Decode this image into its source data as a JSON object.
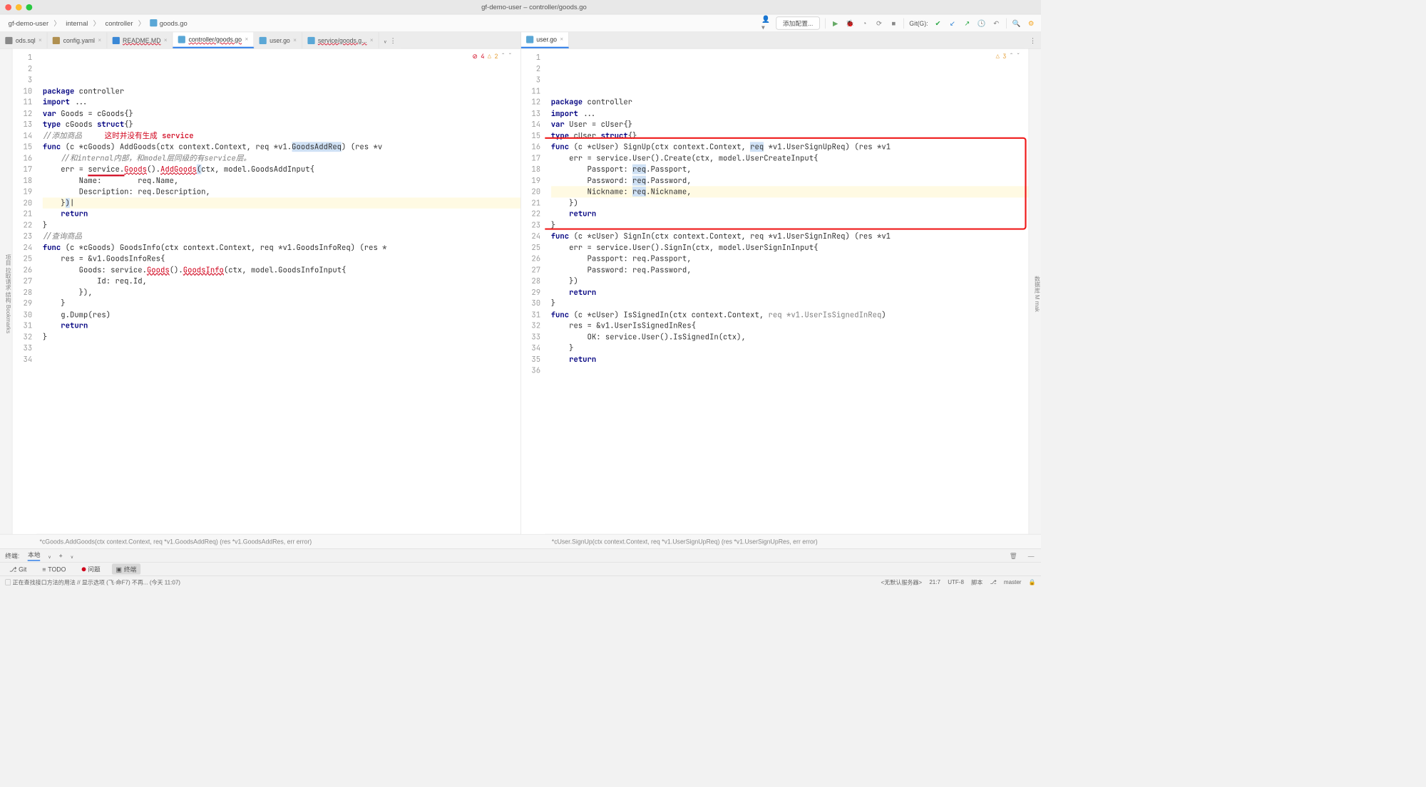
{
  "window": {
    "title": "gf-demo-user – controller/goods.go"
  },
  "breadcrumbs": [
    "gf-demo-user",
    "internal",
    "controller",
    "goods.go"
  ],
  "toolbar": {
    "config_label": "添加配置...",
    "git_label": "Git(G):"
  },
  "tabs_left": [
    {
      "label": "ods.sql",
      "icon": "sql"
    },
    {
      "label": "config.yaml",
      "icon": "yaml"
    },
    {
      "label": "README.MD",
      "icon": "md",
      "wavy": true
    },
    {
      "label": "controller/goods.go",
      "icon": "go",
      "active": true,
      "wavy": true
    },
    {
      "label": "user.go",
      "icon": "go"
    },
    {
      "label": "service/goods.g...",
      "icon": "go",
      "wavy": true
    }
  ],
  "tabs_right": [
    {
      "label": "user.go",
      "icon": "go",
      "active": true
    }
  ],
  "left_editor": {
    "errors": 4,
    "warnings": 2,
    "gutter": [
      "1",
      "2",
      "3",
      "10",
      "11",
      "12",
      "13",
      "14",
      "15",
      "16",
      "17",
      "18",
      "19",
      "20",
      "21",
      "22",
      "23",
      "24",
      "25",
      "26",
      "27",
      "28",
      "29",
      "30",
      "31",
      "32",
      "33",
      "34"
    ],
    "lines": [
      {
        "t": "package controller",
        "parts": [
          [
            "kw",
            "package "
          ],
          [
            "",
            "controller"
          ]
        ]
      },
      {
        "t": ""
      },
      {
        "t": "import ...",
        "parts": [
          [
            "kw",
            "import "
          ],
          [
            "",
            "..."
          ]
        ]
      },
      {
        "t": ""
      },
      {
        "t": "var Goods = cGoods{}",
        "parts": [
          [
            "kw",
            "var "
          ],
          [
            "",
            "Goods = cGoods{}"
          ]
        ]
      },
      {
        "t": ""
      },
      {
        "t": "type cGoods struct{}",
        "parts": [
          [
            "kw",
            "type "
          ],
          [
            "",
            "cGoods "
          ],
          [
            "kw",
            "struct"
          ],
          [
            "",
            "{}"
          ]
        ]
      },
      {
        "t": ""
      },
      {
        "t": "//添加商品     这时并没有生成 service",
        "parts": [
          [
            "cmt",
            "//添加商品     "
          ],
          [
            "errtxt",
            "这时并没有生成 service"
          ]
        ]
      },
      {
        "t": "func (c *cGoods) AddGoods(ctx context.Context, req *v1.GoodsAddReq) (res *v",
        "parts": [
          [
            "kw",
            "func "
          ],
          [
            "",
            "(c *cGoods) AddGoods(ctx context.Context, req *v1."
          ],
          [
            "sel",
            "GoodsAddReq"
          ],
          [
            "",
            ") (res *v"
          ]
        ]
      },
      {
        "t": "    //和internal内部，和model层同级的有service层。",
        "parts": [
          [
            "cmti",
            "    //和internal内部，和model层同级的有service层。"
          ]
        ]
      },
      {
        "t": "    err = service.Goods().AddGoods(ctx, model.GoodsAddInput{",
        "parts": [
          [
            "",
            "    err = "
          ],
          [
            "red-under",
            "service"
          ],
          [
            "",
            ""
          ],
          [
            "red-under",
            "."
          ],
          [
            "err",
            "Goods"
          ],
          [
            "",
            "()."
          ],
          [
            "err",
            "AddGoods"
          ],
          [
            "sel",
            "("
          ],
          [
            "",
            "ctx, model.GoodsAddInput{"
          ]
        ]
      },
      {
        "t": "        Name:        req.Name,",
        "parts": [
          [
            "",
            "        Name:        req.Name,"
          ]
        ]
      },
      {
        "t": "        Description: req.Description,",
        "parts": [
          [
            "",
            "        Description: req.Description,"
          ]
        ]
      },
      {
        "t": "    })",
        "hl": true,
        "parts": [
          [
            "",
            "    }"
          ],
          [
            "sel",
            ")"
          ],
          [
            "",
            "|"
          ]
        ]
      },
      {
        "t": "    return",
        "parts": [
          [
            "",
            "    "
          ],
          [
            "kw",
            "return"
          ]
        ]
      },
      {
        "t": "}",
        "parts": [
          [
            "",
            "}"
          ]
        ]
      },
      {
        "t": ""
      },
      {
        "t": "//查询商品",
        "parts": [
          [
            "cmt",
            "//查询商品"
          ]
        ]
      },
      {
        "t": "func (c *cGoods) GoodsInfo(ctx context.Context, req *v1.GoodsInfoReq) (res *",
        "parts": [
          [
            "kw",
            "func "
          ],
          [
            "",
            "(c *cGoods) GoodsInfo(ctx context.Context, req *v1.GoodsInfoReq) (res *"
          ]
        ]
      },
      {
        "t": "    res = &v1.GoodsInfoRes{",
        "parts": [
          [
            "",
            "    res = &v1.GoodsInfoRes{"
          ]
        ]
      },
      {
        "t": "        Goods: service.Goods().GoodsInfo(ctx, model.GoodsInfoInput{",
        "parts": [
          [
            "",
            "        Goods: service."
          ],
          [
            "err",
            "Goods"
          ],
          [
            "",
            "()."
          ],
          [
            "err",
            "GoodsInfo"
          ],
          [
            "",
            "(ctx, model.GoodsInfoInput{"
          ]
        ]
      },
      {
        "t": "            Id: req.Id,",
        "parts": [
          [
            "",
            "            Id: req.Id,"
          ]
        ]
      },
      {
        "t": "        }),",
        "parts": [
          [
            "",
            "        }),"
          ]
        ]
      },
      {
        "t": "    }",
        "parts": [
          [
            "",
            "    }"
          ]
        ]
      },
      {
        "t": "    g.Dump(res)",
        "parts": [
          [
            "",
            "    g.Dump(res)"
          ]
        ]
      },
      {
        "t": "    return",
        "parts": [
          [
            "",
            "    "
          ],
          [
            "kw",
            "return"
          ]
        ]
      },
      {
        "t": "}",
        "parts": [
          [
            "",
            "}"
          ]
        ]
      }
    ],
    "crumb": "*cGoods.AddGoods(ctx context.Context, req *v1.GoodsAddReq) (res *v1.GoodsAddRes, err error)"
  },
  "right_editor": {
    "warnings": 3,
    "gutter": [
      "1",
      "2",
      "3",
      "11",
      "12",
      "13",
      "14",
      "15",
      "16",
      "17",
      "18",
      "19",
      "20",
      "21",
      "22",
      "23",
      "24",
      "25",
      "26",
      "27",
      "28",
      "29",
      "30",
      "31",
      "32",
      "33",
      "34",
      "35",
      "36"
    ],
    "lines": [
      {
        "t": "package controller",
        "parts": [
          [
            "kw",
            "package "
          ],
          [
            "",
            "controller"
          ]
        ]
      },
      {
        "t": ""
      },
      {
        "t": "import ...",
        "parts": [
          [
            "kw",
            "import "
          ],
          [
            "",
            "..."
          ]
        ]
      },
      {
        "t": ""
      },
      {
        "t": "var User = cUser{}",
        "parts": [
          [
            "kw",
            "var "
          ],
          [
            "",
            "User = cUser{}"
          ]
        ]
      },
      {
        "t": ""
      },
      {
        "t": "type cUser struct{}",
        "parts": [
          [
            "kw",
            "type "
          ],
          [
            "",
            "cUser "
          ],
          [
            "kw",
            "struct"
          ],
          [
            "",
            "{}"
          ]
        ]
      },
      {
        "t": ""
      },
      {
        "t": "func (c *cUser) SignUp(ctx context.Context, req *v1.UserSignUpReq) (res *v1",
        "parts": [
          [
            "kw",
            "func "
          ],
          [
            "",
            "(c *cUser) SignUp(ctx context.Context, "
          ],
          [
            "sel",
            "req"
          ],
          [
            "",
            " *v1.UserSignUpReq) (res *v1"
          ]
        ]
      },
      {
        "t": "    err = service.User().Create(ctx, model.UserCreateInput{",
        "parts": [
          [
            "",
            "    err = service.User().Create(ctx, model.UserCreateInput{"
          ]
        ]
      },
      {
        "t": "        Passport: req.Passport,",
        "parts": [
          [
            "",
            "        Passport: "
          ],
          [
            "sel",
            "req"
          ],
          [
            "",
            ".Passport,"
          ]
        ]
      },
      {
        "t": "        Password: req.Password,",
        "parts": [
          [
            "",
            "        Password: "
          ],
          [
            "sel",
            "req"
          ],
          [
            "",
            ".Password,"
          ]
        ]
      },
      {
        "t": "        Nickname: req.Nickname,",
        "hl": true,
        "parts": [
          [
            "",
            "        Nickname: "
          ],
          [
            "sel",
            "req"
          ],
          [
            "",
            ".Nickname,"
          ]
        ]
      },
      {
        "t": "    })",
        "parts": [
          [
            "",
            "    })"
          ]
        ]
      },
      {
        "t": "    return",
        "parts": [
          [
            "",
            "    "
          ],
          [
            "kw",
            "return"
          ]
        ]
      },
      {
        "t": "}",
        "parts": [
          [
            "",
            "}"
          ]
        ]
      },
      {
        "t": "func (c *cUser) SignIn(ctx context.Context, req *v1.UserSignInReq) (res *v1",
        "parts": [
          [
            "kw",
            "func "
          ],
          [
            "",
            "(c *cUser) SignIn(ctx context.Context, req *v1.UserSignInReq) (res *v1"
          ]
        ]
      },
      {
        "t": "    err = service.User().SignIn(ctx, model.UserSignInInput{",
        "parts": [
          [
            "",
            "    err = service.User().SignIn(ctx, model.UserSignInInput{"
          ]
        ]
      },
      {
        "t": "        Passport: req.Passport,",
        "parts": [
          [
            "",
            "        Passport: req.Passport,"
          ]
        ]
      },
      {
        "t": "        Password: req.Password,",
        "parts": [
          [
            "",
            "        Password: req.Password,"
          ]
        ]
      },
      {
        "t": "    })",
        "parts": [
          [
            "",
            "    })"
          ]
        ]
      },
      {
        "t": "    return",
        "parts": [
          [
            "",
            "    "
          ],
          [
            "kw",
            "return"
          ]
        ]
      },
      {
        "t": "}",
        "parts": [
          [
            "",
            "}"
          ]
        ]
      },
      {
        "t": ""
      },
      {
        "t": "func (c *cUser) IsSignedIn(ctx context.Context, req *v1.UserIsSignedInReq)",
        "parts": [
          [
            "kw",
            "func "
          ],
          [
            "",
            "(c *cUser) IsSignedIn(ctx context.Context, "
          ],
          [
            "param",
            "req *v1.UserIsSignedInReq"
          ],
          [
            "",
            ")"
          ]
        ]
      },
      {
        "t": "    res = &v1.UserIsSignedInRes{",
        "parts": [
          [
            "",
            "    res = &v1.UserIsSignedInRes{"
          ]
        ]
      },
      {
        "t": "        OK: service.User().IsSignedIn(ctx),",
        "parts": [
          [
            "",
            "        OK: service.User().IsSignedIn(ctx),"
          ]
        ]
      },
      {
        "t": "    }",
        "parts": [
          [
            "",
            "    }"
          ]
        ]
      },
      {
        "t": "    return",
        "parts": [
          [
            "",
            "    "
          ],
          [
            "kw",
            "return"
          ]
        ]
      }
    ],
    "crumb": "*cUser.SignUp(ctx context.Context, req *v1.UserSignUpReq) (res *v1.UserSignUpRes, err error)"
  },
  "terminal": {
    "label": "终端:",
    "local": "本地",
    "plus": "+"
  },
  "bottom_tools": {
    "git": "Git",
    "todo": "TODO",
    "problems": "问题",
    "terminal": "终端"
  },
  "status": {
    "msg": "正在查找接口方法的用法 // 显示选项 (飞·命F7)   不再... (今天 11:07)",
    "pos": "21:7",
    "enc": "UTF-8",
    "branch": "master",
    "server": "<无默认服务器>",
    "lock": "🔒"
  },
  "left_strip": {
    "a": "项目",
    "b": "拉取请求",
    "c": "结构",
    "d": "Bookmarks"
  },
  "right_strip": {
    "a": "数据库",
    "b": "M",
    "c": "mak"
  }
}
